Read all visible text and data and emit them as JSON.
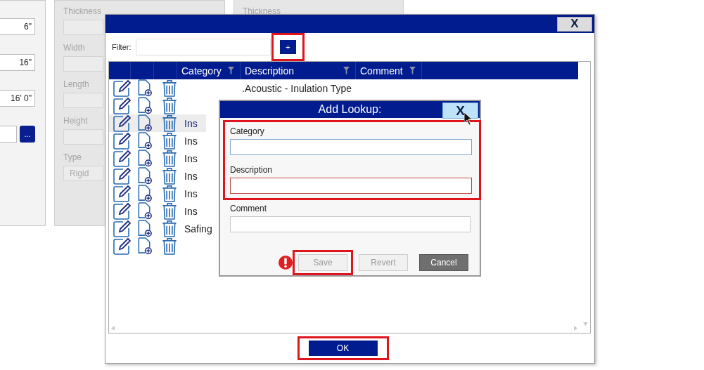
{
  "background": {
    "left_fields": [
      "6\"",
      "16\"",
      "16' 0\""
    ],
    "browse_button": "...",
    "middle_panel": [
      {
        "label": "Thickness"
      },
      {
        "label": "Width"
      },
      {
        "label": "Length"
      },
      {
        "label": "Height"
      },
      {
        "label": "Type",
        "value": "Rigid"
      }
    ],
    "right_panel_label": "Thickness"
  },
  "lookup_window": {
    "close": "X",
    "filter": {
      "label": "Filter:",
      "add_button": "+",
      "add_highlighted": true
    },
    "columns": [
      {
        "label": "Category",
        "filter": true
      },
      {
        "label": "Description",
        "filter": true
      },
      {
        "label": "Comment",
        "filter": true
      }
    ],
    "rows": [
      {
        "description": ".Acoustic - Inulation Type",
        "selected": false
      },
      {
        "selected": false
      },
      {
        "category": "Ins",
        "selected": true
      },
      {
        "category": "Ins",
        "selected": false
      },
      {
        "category": "Ins",
        "selected": false
      },
      {
        "category": "Ins",
        "selected": false
      },
      {
        "category": "Ins",
        "selected": false
      },
      {
        "category": "Ins",
        "selected": false
      },
      {
        "category": "Safing",
        "selected": false
      },
      {
        "selected": false
      }
    ],
    "ok": {
      "label": "OK",
      "highlighted": true
    }
  },
  "dialog": {
    "title": "Add Lookup:",
    "close": "X",
    "fields_highlighted": true,
    "fields": [
      {
        "label": "Category",
        "invalid": false,
        "focused": true
      },
      {
        "label": "Description",
        "invalid": true,
        "focused": false
      },
      {
        "label": "Comment",
        "invalid": false,
        "focused": false
      }
    ],
    "warning": true,
    "buttons": [
      {
        "label": "Save",
        "kind": "save",
        "disabled": true,
        "highlighted": true
      },
      {
        "label": "Revert",
        "kind": "revert",
        "disabled": true,
        "highlighted": false
      },
      {
        "label": "Cancel",
        "kind": "cancel",
        "disabled": false,
        "highlighted": false
      }
    ]
  }
}
